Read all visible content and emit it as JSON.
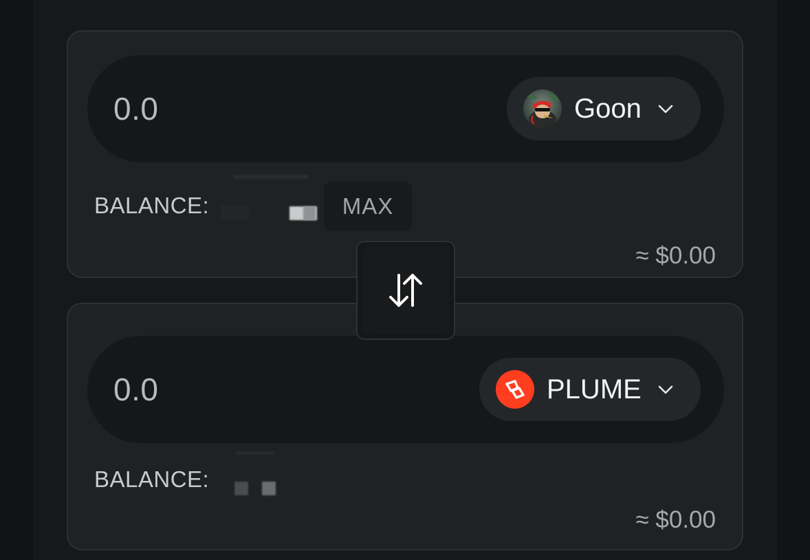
{
  "from": {
    "amount": "0.0",
    "token": {
      "name": "Goon",
      "icon": "goon-avatar-icon"
    },
    "balance_label": "BALANCE:",
    "max_label": "MAX",
    "usd_value": "≈ $0.00"
  },
  "to": {
    "amount": "0.0",
    "token": {
      "name": "PLUME",
      "icon": "plume-logo-icon"
    },
    "balance_label": "BALANCE:",
    "usd_value": "≈ $0.00"
  },
  "swap": {
    "icon": "swap-arrows-icon"
  },
  "colors": {
    "background": "#111314",
    "panel": "#1f2122",
    "input": "#151718",
    "plume_accent": "#ff3d1f"
  }
}
